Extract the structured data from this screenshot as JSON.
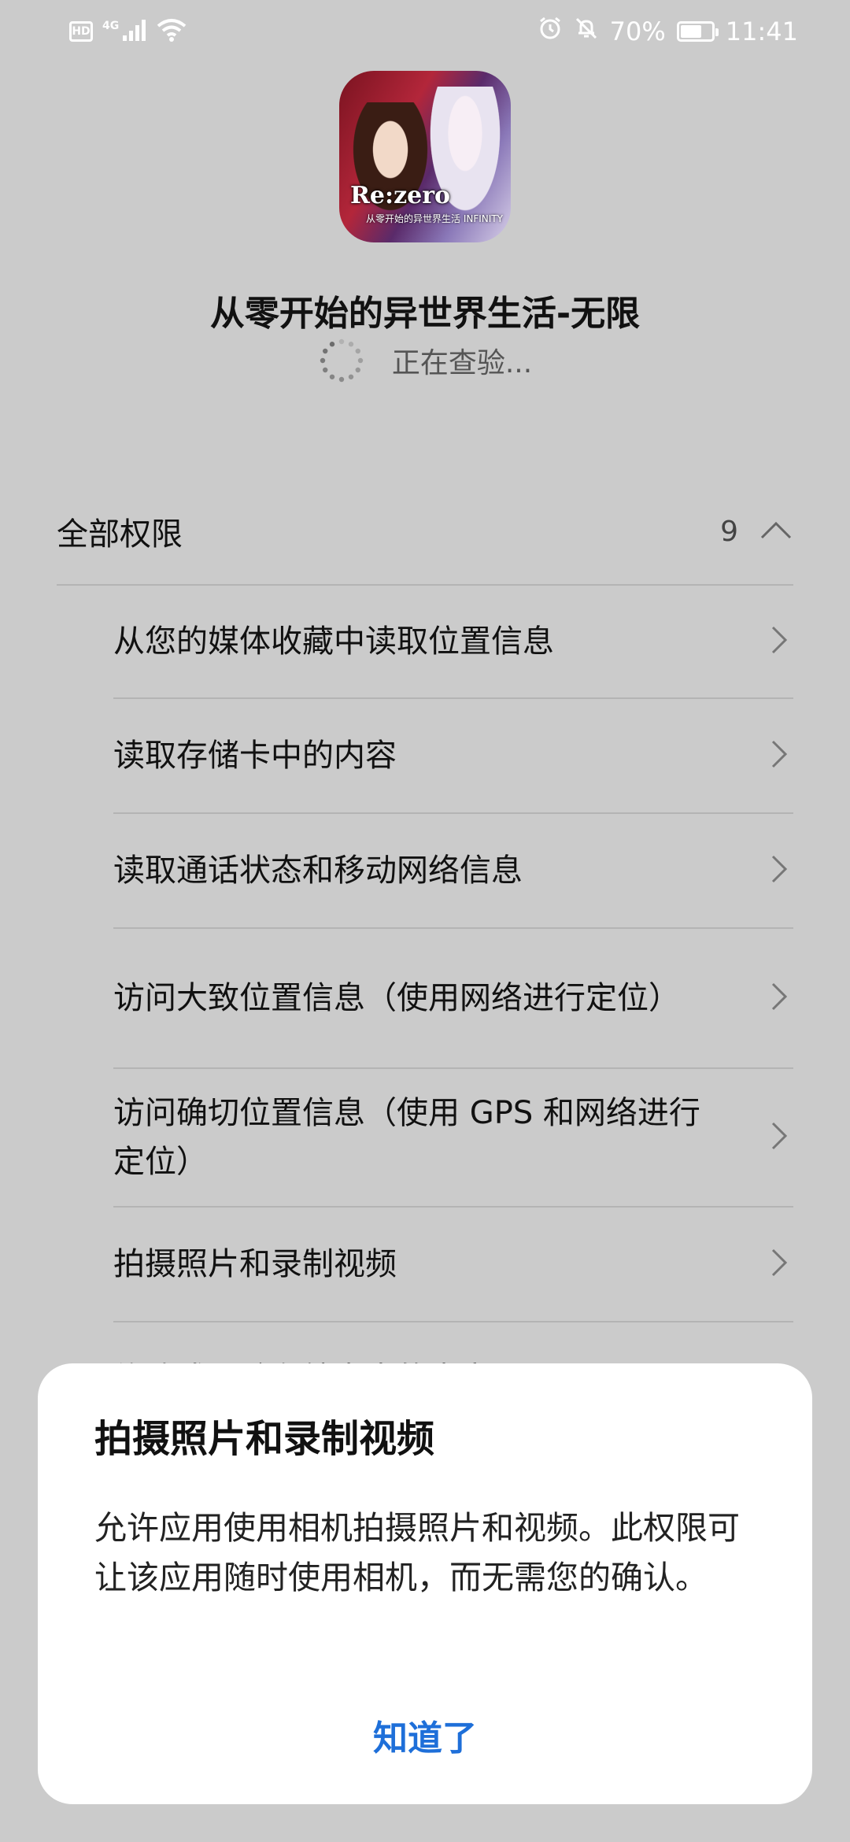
{
  "status_bar": {
    "hd": "HD",
    "network": "4G",
    "battery_percent": "70%",
    "battery_level": 0.7,
    "time": "11:41",
    "icons": [
      "signal-icon",
      "wifi-icon",
      "alarm-icon",
      "mute-icon",
      "battery-icon"
    ]
  },
  "app": {
    "icon": "app-icon-rezero",
    "logo_text": "Re:zero",
    "logo_sub": "从零开始的异世界生活 INFINITY",
    "name": "从零开始的异世界生活-无限",
    "status": "正在查验..."
  },
  "permissions": {
    "title": "全部权限",
    "count": "9",
    "items": [
      {
        "label": "从您的媒体收藏中读取位置信息"
      },
      {
        "label": "读取存储卡中的内容"
      },
      {
        "label": "读取通话状态和移动网络信息"
      },
      {
        "label": "访问大致位置信息（使用网络进行定位）"
      },
      {
        "label": "访问确切位置信息（使用 GPS 和网络进行定位）"
      },
      {
        "label": "拍摄照片和录制视频"
      },
      {
        "label": "修改或删除存储卡中的内容"
      }
    ]
  },
  "dialog": {
    "title": "拍摄照片和录制视频",
    "body": "允许应用使用相机拍摄照片和视频。此权限可让该应用随时使用相机，而无需您的确认。",
    "button": "知道了"
  },
  "colors": {
    "background_dimmed": "#cbcbcb",
    "accent": "#1e6fd9",
    "divider": "#b4b4b4"
  }
}
